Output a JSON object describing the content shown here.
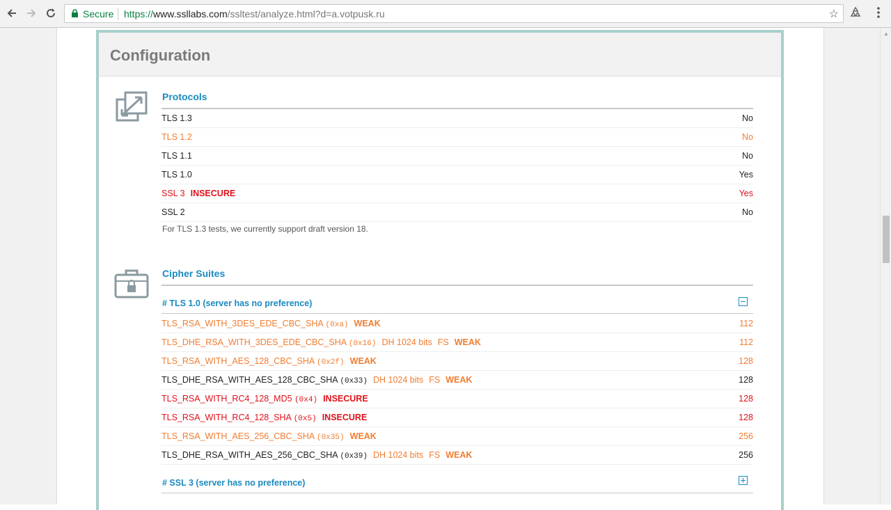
{
  "browser": {
    "secure_label": "Secure",
    "url_scheme": "https://",
    "url_host": "www.ssllabs.com",
    "url_path": "/ssltest/analyze.html?d=a.votpusk.ru"
  },
  "panel": {
    "title": "Configuration"
  },
  "protocols": {
    "title": "Protocols",
    "rows": [
      {
        "name": "TLS 1.3",
        "tag": "",
        "value": "No",
        "color": "#222222"
      },
      {
        "name": "TLS 1.2",
        "tag": "",
        "value": "No",
        "color": "#f07d31"
      },
      {
        "name": "TLS 1.1",
        "tag": "",
        "value": "No",
        "color": "#222222"
      },
      {
        "name": "TLS 1.0",
        "tag": "",
        "value": "Yes",
        "color": "#222222"
      },
      {
        "name": "SSL 3",
        "tag": "INSECURE",
        "value": "Yes",
        "color": "#e0121b"
      },
      {
        "name": "SSL 2",
        "tag": "",
        "value": "No",
        "color": "#222222"
      }
    ],
    "note": "For TLS 1.3 tests, we currently support draft version 18."
  },
  "cipher_suites": {
    "title": "Cipher Suites",
    "group_tls10": {
      "label": "# TLS 1.0 (server has no preference)",
      "rows": [
        {
          "name": "TLS_RSA_WITH_3DES_EDE_CBC_SHA",
          "hex": "(0xa)",
          "dh": "",
          "fs": "",
          "tag": "WEAK",
          "bits": "112",
          "color": "#f07d31"
        },
        {
          "name": "TLS_DHE_RSA_WITH_3DES_EDE_CBC_SHA",
          "hex": "(0x16)",
          "dh": "DH 1024 bits",
          "fs": "FS",
          "tag": "WEAK",
          "bits": "112",
          "color": "#f07d31"
        },
        {
          "name": "TLS_RSA_WITH_AES_128_CBC_SHA",
          "hex": "(0x2f)",
          "dh": "",
          "fs": "",
          "tag": "WEAK",
          "bits": "128",
          "color": "#f07d31"
        },
        {
          "name": "TLS_DHE_RSA_WITH_AES_128_CBC_SHA",
          "hex": "(0x33)",
          "dh": "DH 1024 bits",
          "fs": "FS",
          "tag": "WEAK",
          "bits": "128",
          "color": "#222222"
        },
        {
          "name": "TLS_RSA_WITH_RC4_128_MD5",
          "hex": "(0x4)",
          "dh": "",
          "fs": "",
          "tag": "INSECURE",
          "bits": "128",
          "color": "#e0121b"
        },
        {
          "name": "TLS_RSA_WITH_RC4_128_SHA",
          "hex": "(0x5)",
          "dh": "",
          "fs": "",
          "tag": "INSECURE",
          "bits": "128",
          "color": "#e0121b"
        },
        {
          "name": "TLS_RSA_WITH_AES_256_CBC_SHA",
          "hex": "(0x35)",
          "dh": "",
          "fs": "",
          "tag": "WEAK",
          "bits": "256",
          "color": "#f07d31"
        },
        {
          "name": "TLS_DHE_RSA_WITH_AES_256_CBC_SHA",
          "hex": "(0x39)",
          "dh": "DH 1024 bits",
          "fs": "FS",
          "tag": "WEAK",
          "bits": "256",
          "color": "#222222"
        }
      ]
    },
    "group_ssl3": {
      "label": "# SSL 3 (server has no preference)"
    }
  },
  "colors": {
    "accent": "#1a8abf",
    "weak": "#f07d31",
    "insecure": "#e0121b",
    "panel_border": "#a9cfcc"
  },
  "icons": [
    "back-icon",
    "forward-icon",
    "reload-icon",
    "lock-icon",
    "star-icon",
    "extension-icon",
    "menu-icon",
    "protocols-icon",
    "cipher-suites-icon",
    "collapse-icon",
    "expand-icon"
  ]
}
